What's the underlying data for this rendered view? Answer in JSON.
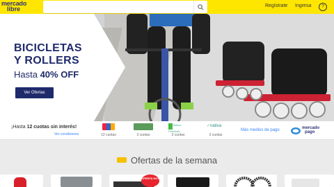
{
  "header": {
    "logo_line1": "mercado",
    "logo_line2": "libre",
    "search_placeholder": "",
    "register": "Regístrate",
    "login": "Ingresa",
    "help": "?"
  },
  "hero": {
    "title_line1": "BICICLETAS",
    "title_line2": "Y ROLLERS",
    "subtitle_prefix": "Hasta ",
    "subtitle_bold": "40% OFF",
    "cta": "Ver Ofertas"
  },
  "payments": {
    "title_prefix": "¡Hasta ",
    "title_bold": "12 cuotas sin interés!",
    "conditions": "Ver condiciones",
    "items": [
      {
        "label": "12 cuotas",
        "brand": "card-logos"
      },
      {
        "label": "3 cuotas",
        "brand": "card-green"
      },
      {
        "label": "3 cuotas",
        "brand": "Banco Provincia"
      },
      {
        "label": "3 cuotas",
        "brand": "nativa"
      }
    ],
    "more": "Más medios de pago",
    "mp_line1": "mercado",
    "mp_line2": "pago"
  },
  "offers": {
    "title": "Ofertas de la semana",
    "badge": "OFERTA HOT"
  },
  "colors": {
    "header": "#ffe600",
    "brand_blue": "#2d3277",
    "cta": "#1f2a6b",
    "link": "#3483fa"
  }
}
